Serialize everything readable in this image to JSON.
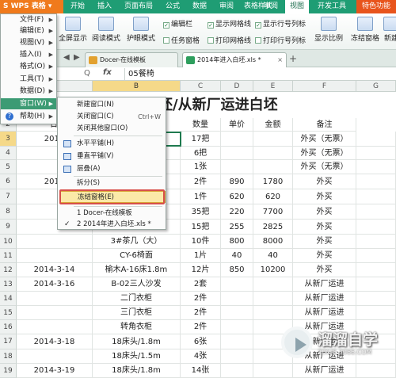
{
  "app_button": {
    "label": "S WPS 表格",
    "arrow": "▾"
  },
  "tabs": [
    {
      "label": "开始"
    },
    {
      "label": "插入"
    },
    {
      "label": "页面布局"
    },
    {
      "label": "公式"
    },
    {
      "label": "数据"
    },
    {
      "label": "审阅"
    },
    {
      "label": "表格样式"
    },
    {
      "label": "审阅"
    },
    {
      "label": "视图"
    },
    {
      "label": "开发工具"
    },
    {
      "label": "特色功能"
    }
  ],
  "ribbon": {
    "fullscreen": "全屏显示",
    "reading_mode": "阅读模式",
    "protect_mode": "护眼模式",
    "chk_editbar": "编辑栏",
    "chk_taskpane": "任务窗格",
    "chk_showgrid": "显示网格线",
    "chk_printgrid": "打印网格线",
    "chk_showheaders": "显示行号列标",
    "chk_printheaders": "打印行号列标",
    "zoom": "显示比例",
    "freeze": "冻结窗格",
    "new": "新建"
  },
  "doc_tabs": {
    "tab1": "Docer-在线模板",
    "tab2": "2014年进入白坯.xls *",
    "close": "×",
    "add": "+"
  },
  "formula_bar": {
    "lookup_icon": "Q",
    "fx": "fx",
    "value": "05餐椅"
  },
  "columns": [
    "A",
    "B",
    "C",
    "D",
    "E",
    "F",
    "G"
  ],
  "rows": [
    "1",
    "2",
    "3",
    "4",
    "5",
    "6",
    "7",
    "8",
    "9",
    "10",
    "11",
    "12",
    "13",
    "14",
    "15",
    "16",
    "17",
    "18",
    "19"
  ],
  "title": "坯/从新厂运进白坯",
  "headers": {
    "date": "日",
    "qty": "数量",
    "price": "单价",
    "amount": "金额",
    "note": "备注"
  },
  "table": [
    {
      "a": "2014",
      "b": "",
      "c": "17把",
      "d": "",
      "e": "",
      "f": "外买（无票）"
    },
    {
      "a": "",
      "b": "",
      "c": "6把",
      "d": "",
      "e": "",
      "f": "外买（无票）"
    },
    {
      "a": "",
      "b": "",
      "c": "1张",
      "d": "",
      "e": "",
      "f": "外买（无票）"
    },
    {
      "a": "2014",
      "b": "",
      "c": "2件",
      "d": "890",
      "e": "1780",
      "f": "外买"
    },
    {
      "a": "",
      "b": "",
      "c": "1件",
      "d": "620",
      "e": "620",
      "f": "外买"
    },
    {
      "a": "",
      "b": "",
      "c": "35把",
      "d": "220",
      "e": "7700",
      "f": "外买"
    },
    {
      "a": "",
      "b": "",
      "c": "15把",
      "d": "255",
      "e": "2825",
      "f": "外买"
    },
    {
      "a": "",
      "b": "3#茶几（大）",
      "c": "10件",
      "d": "800",
      "e": "8000",
      "f": "外买"
    },
    {
      "a": "",
      "b": "CY-6椅面",
      "c": "1片",
      "d": "40",
      "e": "40",
      "f": "外买"
    },
    {
      "a": "2014-3-14",
      "b": "榆木A-16床1.8m",
      "c": "12片",
      "d": "850",
      "e": "10200",
      "f": "外买"
    },
    {
      "a": "2014-3-16",
      "b": "B-02三人沙发",
      "c": "2套",
      "d": "",
      "e": "",
      "f": "从新厂运进"
    },
    {
      "a": "",
      "b": "二门衣柜",
      "c": "2件",
      "d": "",
      "e": "",
      "f": "从新厂运进"
    },
    {
      "a": "",
      "b": "三门衣柜",
      "c": "2件",
      "d": "",
      "e": "",
      "f": "从新厂运进"
    },
    {
      "a": "",
      "b": "转角衣柜",
      "c": "2件",
      "d": "",
      "e": "",
      "f": "从新厂运进"
    },
    {
      "a": "2014-3-18",
      "b": "18床头/1.8m",
      "c": "6张",
      "d": "",
      "e": "",
      "f": "从新厂运进"
    },
    {
      "a": "",
      "b": "18床头/1.5m",
      "c": "4张",
      "d": "",
      "e": "",
      "f": "从新厂运进"
    },
    {
      "a": "2014-3-19",
      "b": "18床头/1.8m",
      "c": "14张",
      "d": "",
      "e": "",
      "f": "从新厂运进"
    }
  ],
  "app_menu": [
    {
      "label": "文件(F)"
    },
    {
      "label": "编辑(E)"
    },
    {
      "label": "视图(V)"
    },
    {
      "label": "插入(I)"
    },
    {
      "label": "格式(O)"
    },
    {
      "label": "工具(T)"
    },
    {
      "label": "数据(D)"
    },
    {
      "label": "窗口(W)"
    },
    {
      "label": "帮助(H)"
    }
  ],
  "window_menu": {
    "new_window": "新建窗口(N)",
    "close_window": "关闭窗口(C)",
    "close_window_shortcut": "Ctrl+W",
    "close_others": "关闭其他窗口(O)",
    "tile_h": "水平平铺(H)",
    "tile_v": "垂直平铺(V)",
    "cascade": "层叠(A)",
    "split": "拆分(S)",
    "freeze": "冻结窗格(E)",
    "doc1": "1 Docer-在线模板",
    "doc2": "2 2014年进入白坯.xls *",
    "check": "✓"
  },
  "watermark": {
    "text": "溜溜自学",
    "url": "ZIXUE.3066.COM"
  },
  "colors": {
    "tab_green": "#1f9d74",
    "app_orange": "#f07a1c",
    "menu_highlight": "#3c9b74",
    "freeze_outline": "#d8504a"
  }
}
